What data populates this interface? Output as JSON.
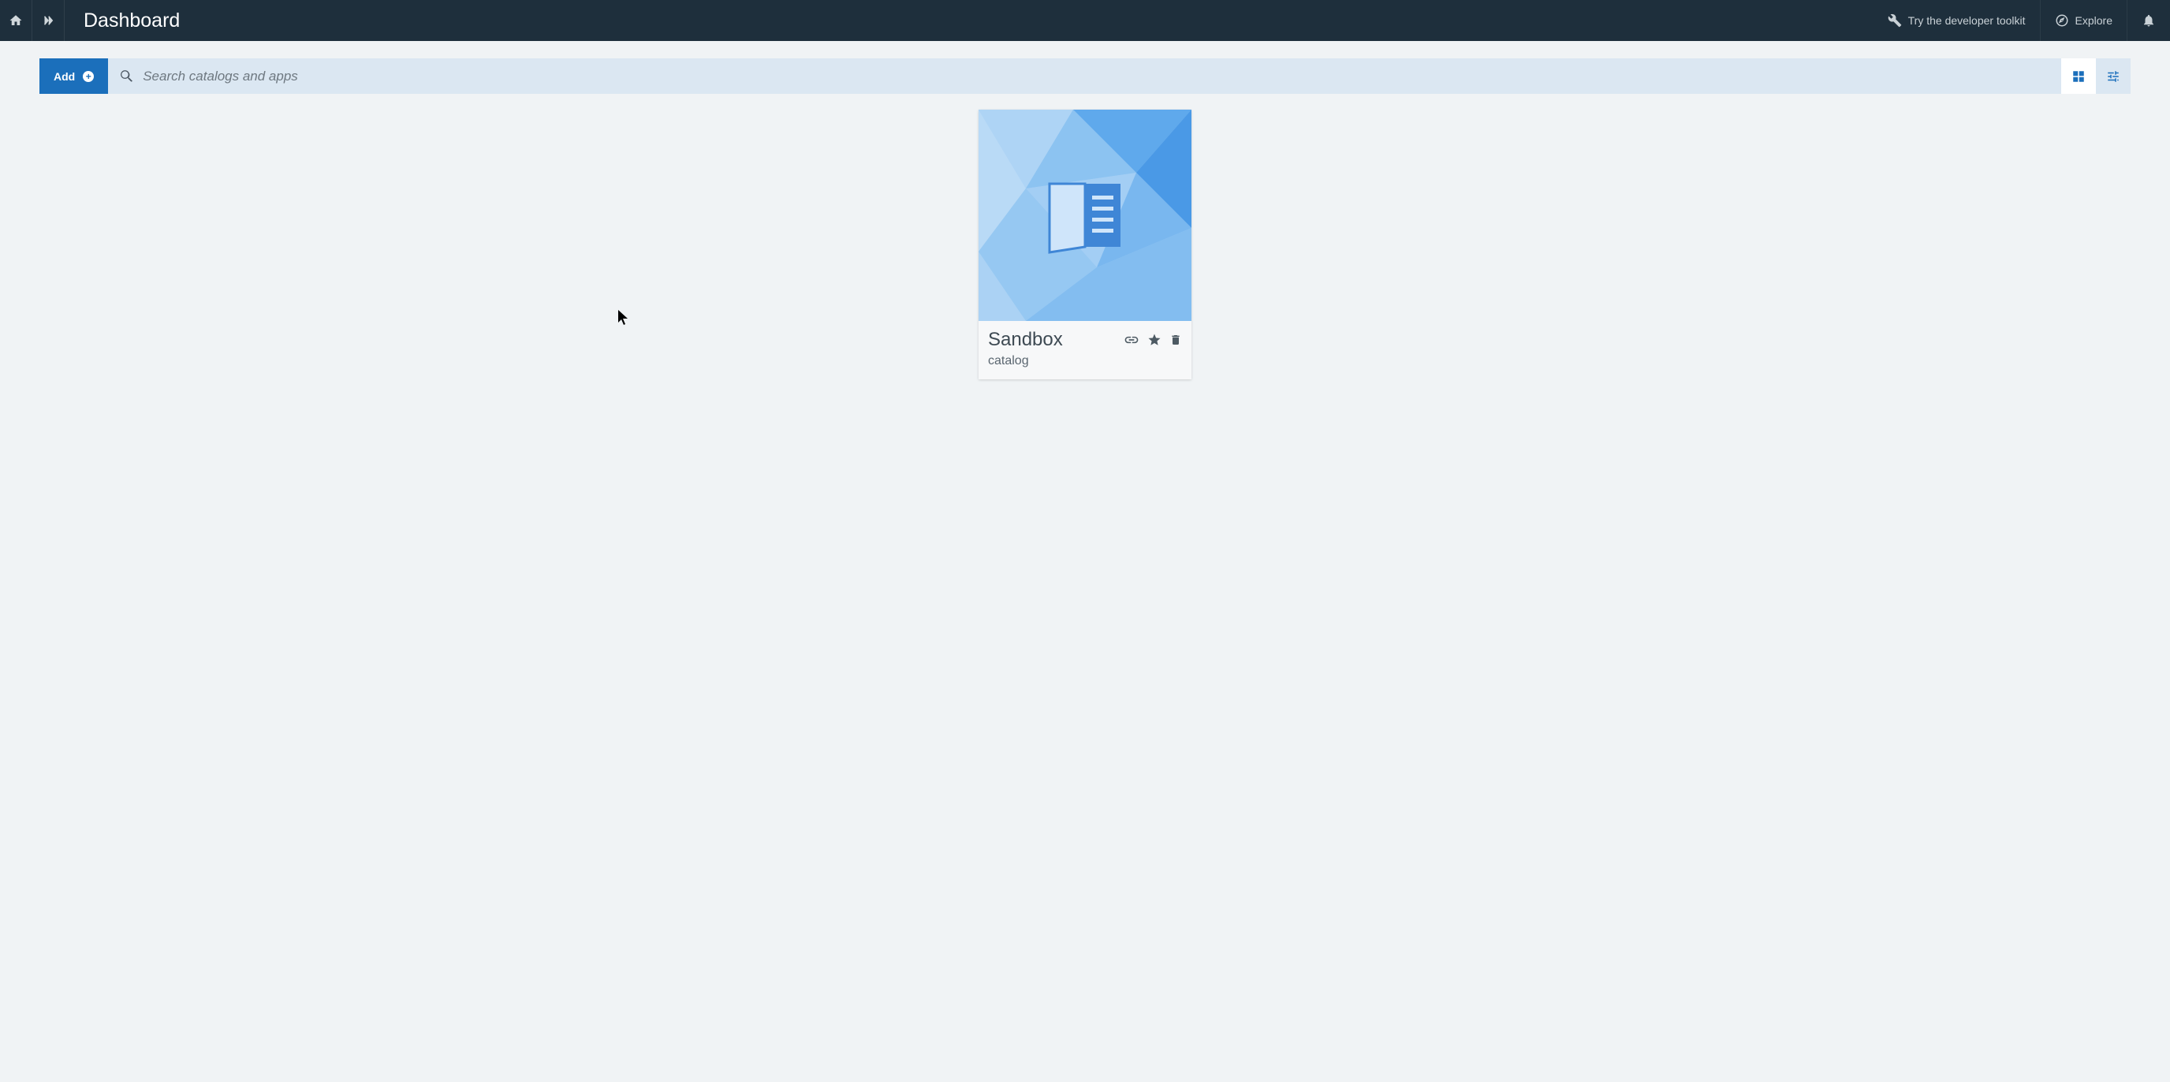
{
  "navbar": {
    "title": "Dashboard",
    "try_toolkit": "Try the developer toolkit",
    "explore": "Explore"
  },
  "toolbar": {
    "add_label": "Add",
    "search_placeholder": "Search catalogs and apps"
  },
  "cards": [
    {
      "title": "Sandbox",
      "subtitle": "catalog"
    }
  ]
}
